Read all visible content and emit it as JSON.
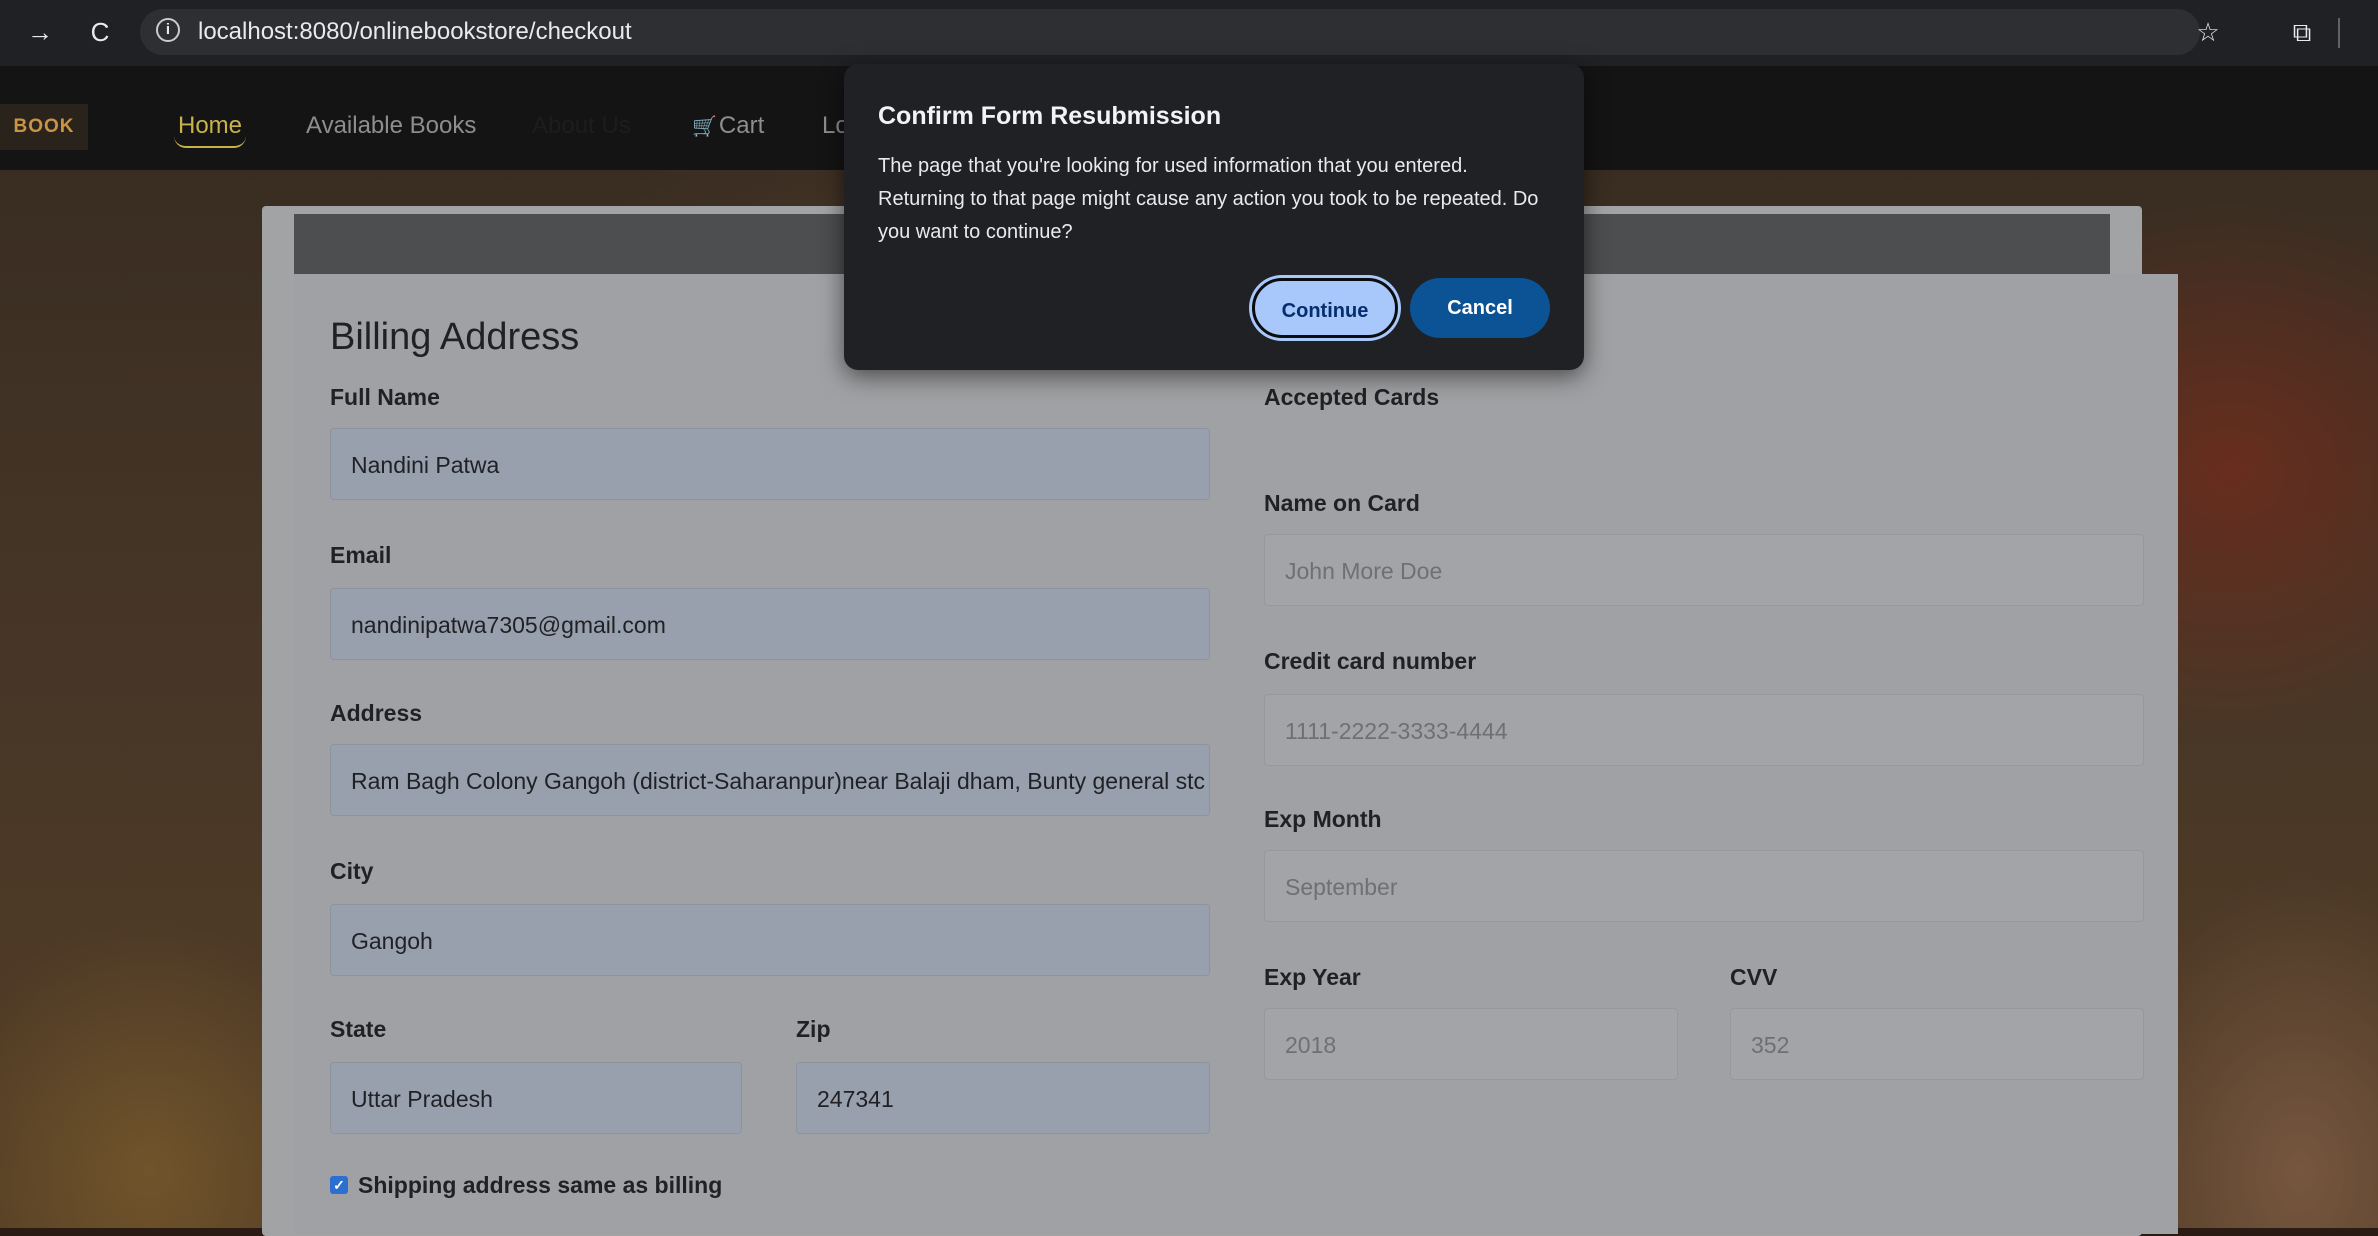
{
  "browser": {
    "back_icon": "→",
    "reload_icon": "C",
    "url": "localhost:8080/onlinebookstore/checkout",
    "star_icon": "☆",
    "extensions_icon": "⧉"
  },
  "navbar": {
    "logo": "BOOK",
    "links": [
      {
        "label": "Home"
      },
      {
        "label": "Available Books"
      },
      {
        "label": "About Us"
      },
      {
        "label": "Cart"
      },
      {
        "label": "Lo"
      }
    ]
  },
  "billing": {
    "heading": "Billing Address",
    "full_name_label": "Full Name",
    "full_name": "Nandini Patwa",
    "email_label": "Email",
    "email": "nandinipatwa7305@gmail.com",
    "address_label": "Address",
    "address": "Ram Bagh Colony Gangoh (district-Saharanpur)near Balaji dham, Bunty general stc",
    "city_label": "City",
    "city": "Gangoh",
    "state_label": "State",
    "state": "Uttar Pradesh",
    "zip_label": "Zip",
    "zip": "247341",
    "shipping_same_label": "Shipping address same as billing",
    "shipping_same_checked": true
  },
  "payment": {
    "accepted_cards_label": "Accepted Cards",
    "name_on_card_label": "Name on Card",
    "name_on_card_placeholder": "John More Doe",
    "card_number_label": "Credit card number",
    "card_number_placeholder": "1111-2222-3333-4444",
    "exp_month_label": "Exp Month",
    "exp_month_placeholder": "September",
    "exp_year_label": "Exp Year",
    "exp_year_placeholder": "2018",
    "cvv_label": "CVV",
    "cvv_placeholder": "352"
  },
  "dialog": {
    "title": "Confirm Form Resubmission",
    "message": "The page that you're looking for used information that you entered. Returning to that page might cause any action you took to be repeated. Do you want to continue?",
    "continue_label": "Continue",
    "cancel_label": "Cancel"
  },
  "colors": {
    "dialog_bg": "#202124",
    "continue_bg": "#a8c7fa",
    "cancel_bg": "#0b5394",
    "nav_active": "#c8b24d"
  }
}
